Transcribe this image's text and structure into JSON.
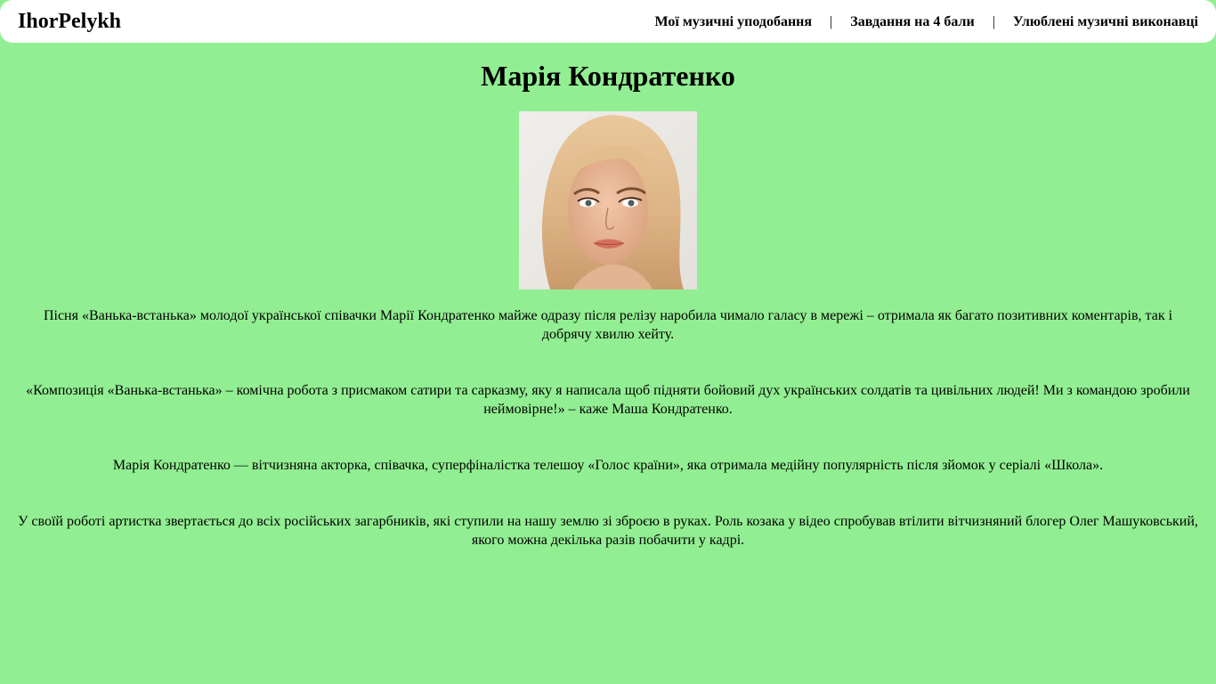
{
  "header": {
    "brand": "IhorPelykh",
    "nav": [
      {
        "label": "Мої музичні уподобання"
      },
      {
        "label": "Завдання на 4 бали"
      },
      {
        "label": "Улюблені музичні виконавці"
      }
    ],
    "separator": "|"
  },
  "main": {
    "title": "Марія Кондратенко",
    "paragraphs": [
      "Пісня «Ванька-встанька» молодої української співачки Марії Кондратенко майже одразу після релізу наробила чимало галасу в мережі – отримала як багато позитивних коментарів, так і добрячу хвилю хейту.",
      "«Композиція «Ванька-встанька» – комічна робота з присмаком сатири та сарказму, яку я написала щоб підняти бойовий дух українських солдатів та цивільних людей! Ми з командою зробили неймовірне!» – каже Маша Кондратенко.",
      "Марія Кондратенко — вітчизняна акторка, співачка, суперфіналістка телешоу «Голос країни», яка отримала медійну популярність після зйомок у серіалі «Школа».",
      "У своїй роботі артистка звертається до всіх російських загарбників, які ступили на нашу землю зі зброєю в руках. Роль козака у відео спробував втілити вітчизняний блогер Олег Машуковський, якого можна декілька разів побачити у кадрі."
    ]
  },
  "colors": {
    "page_background": "#92ee92",
    "navbar_background": "#ffffff"
  }
}
